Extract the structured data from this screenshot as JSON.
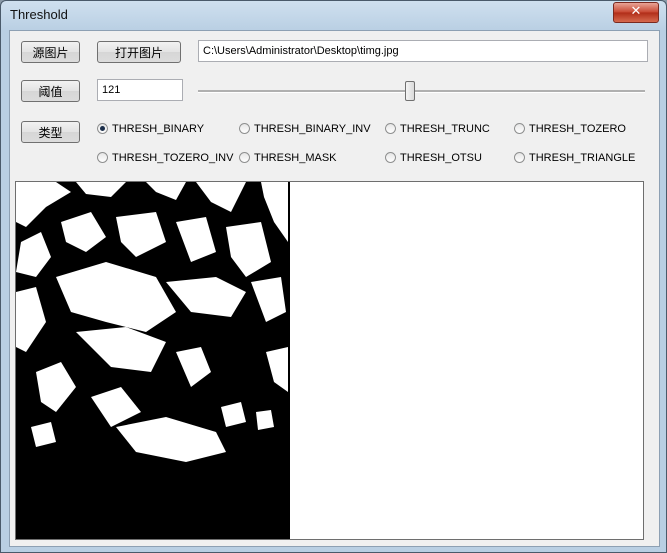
{
  "window": {
    "title": "Threshold",
    "close_glyph": "✕"
  },
  "buttons": {
    "source_image": "源图片",
    "open_image": "打开图片",
    "threshold": "阈值",
    "type": "类型"
  },
  "path": {
    "value": "C:\\Users\\Administrator\\Desktop\\timg.jpg"
  },
  "threshold_value": "121",
  "slider": {
    "value": 121,
    "min": 0,
    "max": 255
  },
  "radios": [
    {
      "label": "THRESH_BINARY",
      "checked": true
    },
    {
      "label": "THRESH_BINARY_INV",
      "checked": false
    },
    {
      "label": "THRESH_TRUNC",
      "checked": false
    },
    {
      "label": "THRESH_TOZERO",
      "checked": false
    },
    {
      "label": "THRESH_TOZERO_INV",
      "checked": false
    },
    {
      "label": "THRESH_MASK",
      "checked": false
    },
    {
      "label": "THRESH_OTSU",
      "checked": false
    },
    {
      "label": "THRESH_TRIANGLE",
      "checked": false
    }
  ]
}
